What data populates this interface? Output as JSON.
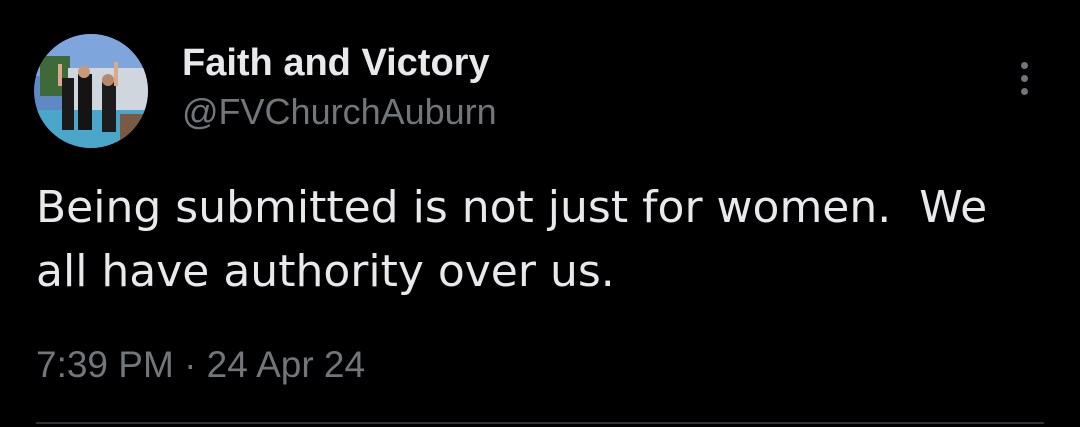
{
  "author": {
    "display_name": "Faith and Victory",
    "handle": "@FVChurchAuburn",
    "avatar": "church-baptism-photo"
  },
  "tweet": {
    "text": "Being submitted is not just for women.  We\nall have authority over us.",
    "timestamp": "7:39 PM · 24 Apr 24"
  },
  "icons": {
    "more": "more-vertical-icon"
  },
  "colors": {
    "background": "#000000",
    "primary_text": "#e7e9ea",
    "secondary_text": "#71767b",
    "divider": "#2f3336"
  }
}
